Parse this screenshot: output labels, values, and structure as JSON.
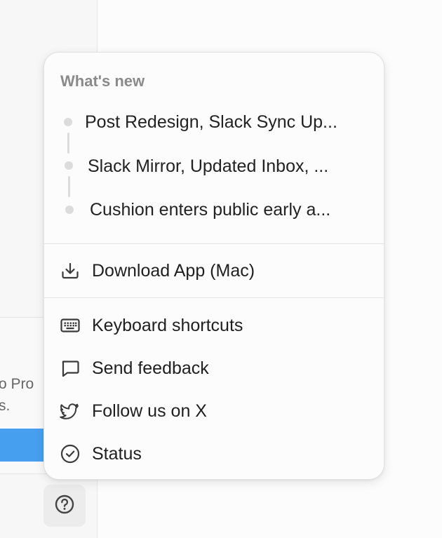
{
  "background": {
    "upgrade_text_lines": [
      "o Pro",
      "s."
    ]
  },
  "menu": {
    "section_title": "What's new",
    "news": [
      {
        "label": "Post Redesign, Slack Sync Up..."
      },
      {
        "label": "Slack Mirror, Updated Inbox, ..."
      },
      {
        "label": "Cushion enters public early a..."
      }
    ],
    "download_label": "Download App (Mac)",
    "items": [
      {
        "label": "Keyboard shortcuts",
        "icon": "keyboard-icon"
      },
      {
        "label": "Send feedback",
        "icon": "speech-bubble-icon"
      },
      {
        "label": "Follow us on X",
        "icon": "twitter-bird-icon"
      },
      {
        "label": "Status",
        "icon": "check-circle-icon"
      }
    ]
  },
  "help": {
    "icon": "question-circle-icon"
  },
  "colors": {
    "accent": "#46a0ef",
    "muted_text": "#8a8a8a",
    "timeline": "#dcdcdc"
  }
}
